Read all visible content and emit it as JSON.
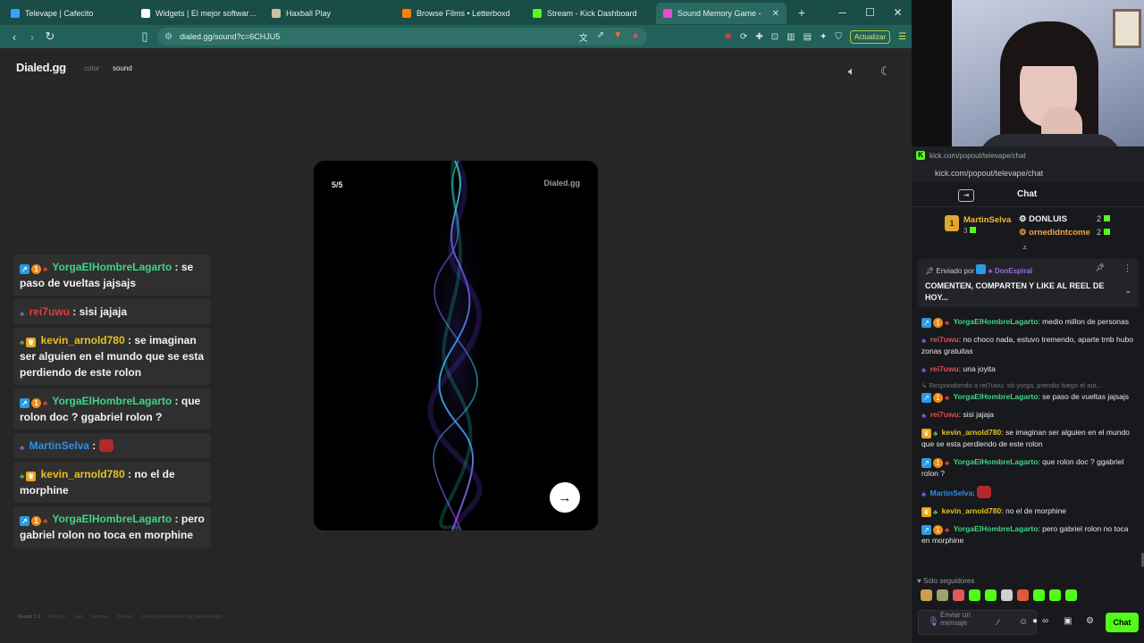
{
  "browser": {
    "tabs": [
      {
        "title": "Televape | Cafecito",
        "color": "#3aa0ff"
      },
      {
        "title": "Widgets | El mejor software para",
        "color": "#ffffff"
      },
      {
        "title": "Haxball Play",
        "color": "#c8c2a0"
      },
      {
        "title": "Browse Films • Letterboxd",
        "color": "#ff8000"
      },
      {
        "title": "Stream - Kick Dashboard",
        "color": "#53fc18"
      },
      {
        "title": "Sound Memory Game - ",
        "color": "#e94bd0",
        "active": true
      }
    ],
    "new_tab": "+",
    "url": "dialed.gg/sound?c=6CHJU5",
    "update_label": "Actualizar"
  },
  "page": {
    "logo": "Dialed.gg",
    "nav_color": "color",
    "nav_sound": "sound",
    "card": {
      "counter": "5/5",
      "brand": "Dialed.gg"
    },
    "footer": [
      "Sound 1.0",
      "Privacy",
      "Lab",
      "Scoring",
      "Socials",
      "Do not sell or share my personal info"
    ]
  },
  "overlay_chat": [
    {
      "badges": [
        "blue",
        "orange",
        "red"
      ],
      "user": "YorgaElHombreLagarto",
      "user_color": "#3fd48a",
      "text": "se paso de vueltas jajsajs"
    },
    {
      "badges": [
        "star"
      ],
      "user": "rei7uwu",
      "user_color": "#e03c3c",
      "text": "sisi jajaja"
    },
    {
      "badges": [
        "leaf",
        "crown"
      ],
      "user": "kevin_arnold780",
      "user_color": "#e6c21e",
      "text": "se imaginan ser alguien en el mundo que se esta perdiendo de este rolon"
    },
    {
      "badges": [
        "blue",
        "orange",
        "red"
      ],
      "user": "YorgaElHombreLagarto",
      "user_color": "#3fd48a",
      "text": "que rolon doc ? ggabriel rolon ?"
    },
    {
      "badges": [
        "star"
      ],
      "user": "MartinSelva",
      "user_color": "#2e8fe8",
      "text": "",
      "emote": true
    },
    {
      "badges": [
        "leaf",
        "crown"
      ],
      "user": "kevin_arnold780",
      "user_color": "#e6c21e",
      "text": "no el de morphine"
    },
    {
      "badges": [
        "blue",
        "orange",
        "red"
      ],
      "user": "YorgaElHombreLagarto",
      "user_color": "#3fd48a",
      "text": "pero gabriel rolon no toca en morphine"
    }
  ],
  "kick": {
    "popup_title": "kick.com/popout/televape/chat",
    "url": "kick.com/popout/televape/chat",
    "header_title": "Chat",
    "leaderboard": {
      "first_name": "MartinSelva",
      "first_count": "3",
      "second_name": "DONLUIS",
      "second_count": "2",
      "third_name": "ornedidntcome",
      "third_count": "2"
    },
    "pinned": {
      "sent_by": "Enviado por",
      "author": "DonEspiral",
      "text": "COMENTEN, COMPARTEN Y LIKE AL REEL DE HOY..."
    },
    "messages": [
      {
        "badges": [
          "blue",
          "orange",
          "red"
        ],
        "user": "YorgaElHombreLagarto",
        "user_color": "#3fd48a",
        "text": "medio millon de personas"
      },
      {
        "badges": [
          "star"
        ],
        "user": "rei7uwu",
        "user_color": "#e05050",
        "text": "no choco nada, estuvo tremendo, aparte tmb hubo zonas gratuitas"
      },
      {
        "badges": [
          "star"
        ],
        "user": "rei7uwu",
        "user_color": "#e05050",
        "text": "una joyita"
      },
      {
        "reply": "Respondiendo a rei7uwu: siii yorga, prendio fuego el aut...",
        "badges": [
          "blue",
          "orange",
          "red"
        ],
        "user": "YorgaElHombreLagarto",
        "user_color": "#3fd48a",
        "text": "se paso de vueltas jajsajs"
      },
      {
        "badges": [
          "star"
        ],
        "user": "rei7uwu",
        "user_color": "#e05050",
        "text": "sisi jajaja"
      },
      {
        "badges": [
          "crown",
          "leaf"
        ],
        "user": "kevin_arnold780",
        "user_color": "#e6c21e",
        "text": "se imaginan ser alguien en el mundo que se esta perdiendo de este rolon"
      },
      {
        "badges": [
          "blue",
          "orange",
          "red"
        ],
        "user": "YorgaElHombreLagarto",
        "user_color": "#3fd48a",
        "text": "que rolon doc ? ggabriel rolon ?"
      },
      {
        "badges": [
          "star"
        ],
        "user": "MartinSelva",
        "user_color": "#2e8fe8",
        "text": "",
        "emote": true
      },
      {
        "badges": [
          "crown",
          "leaf"
        ],
        "user": "kevin_arnold780",
        "user_color": "#e6c21e",
        "text": "no el de morphine"
      },
      {
        "badges": [
          "blue",
          "orange",
          "red"
        ],
        "user": "YorgaElHombreLagarto",
        "user_color": "#3fd48a",
        "text": "pero gabriel rolon no toca en morphine"
      }
    ],
    "followers_only": "Solo seguidores",
    "input_placeholder": "Enviar un mensaje",
    "send_label": "Chat",
    "emote_colors": [
      "#c8a050",
      "#a0a070",
      "#e05a5a",
      "#53fc18",
      "#53fc18",
      "#d0d0d0",
      "#e05a3a",
      "#53fc18",
      "#53fc18",
      "#53fc18"
    ]
  }
}
